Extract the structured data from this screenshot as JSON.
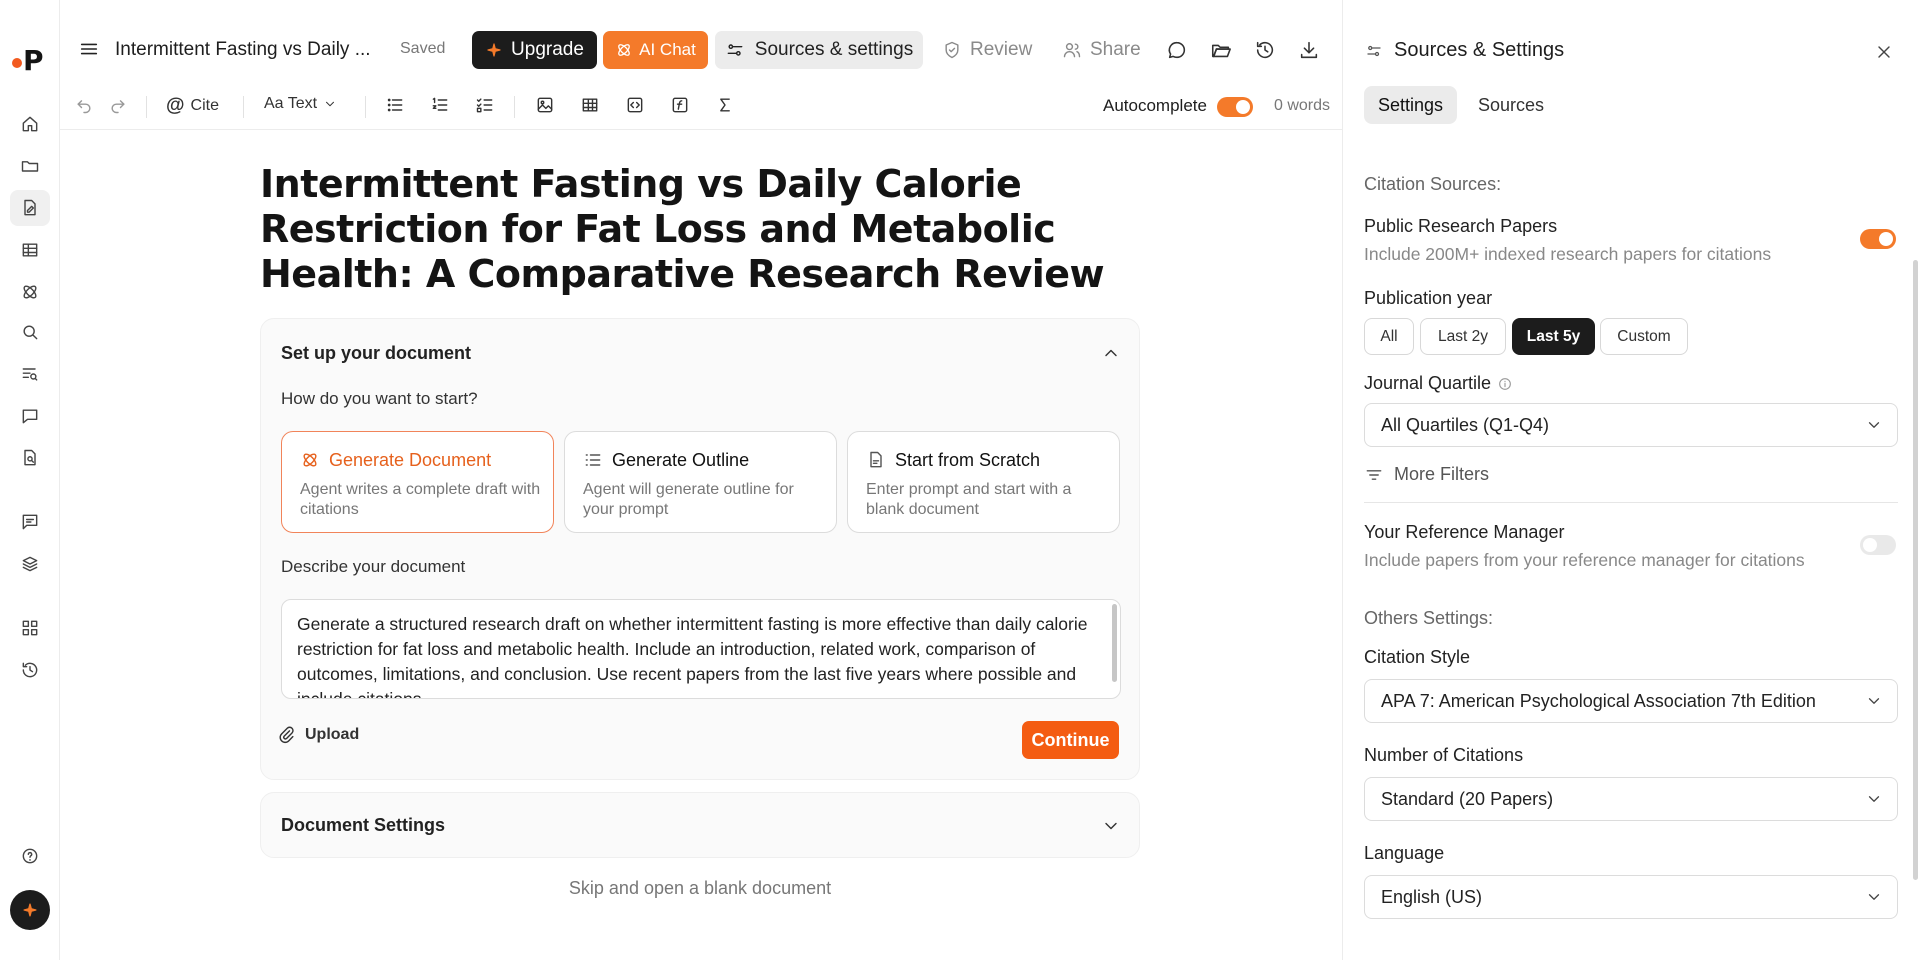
{
  "header": {
    "doc_title": "Intermittent Fasting vs Daily ...",
    "saved": "Saved",
    "upgrade": "Upgrade",
    "ai_chat": "AI Chat",
    "sources_settings": "Sources & settings",
    "review": "Review",
    "share": "Share"
  },
  "toolbar": {
    "cite": "Cite",
    "text_style": "Aa Text",
    "autocomplete": "Autocomplete",
    "autocomplete_on": true,
    "word_count": "0 words"
  },
  "document": {
    "title": "Intermittent Fasting vs Daily Calorie Restriction for Fat Loss and Metabolic Health: A Comparative Research Review"
  },
  "setup": {
    "heading": "Set up your document",
    "question": "How do you want to start?",
    "options": [
      {
        "title": "Generate Document",
        "desc": "Agent writes a complete draft with citations",
        "icon": "atom-icon",
        "selected": true
      },
      {
        "title": "Generate Outline",
        "desc": "Agent will generate outline for your prompt",
        "icon": "list-icon",
        "selected": false
      },
      {
        "title": "Start from Scratch",
        "desc": "Enter prompt and start with a blank document",
        "icon": "file-icon",
        "selected": false
      }
    ],
    "describe_label": "Describe your document",
    "prompt": "Generate a structured research draft on whether intermittent fasting is more effective than daily calorie restriction for fat loss and metabolic health. Include an introduction, related work, comparison of outcomes, limitations, and conclusion. Use recent papers from the last five years where possible and include citations.",
    "upload": "Upload",
    "continue": "Continue"
  },
  "document_settings": "Document Settings",
  "skip": "Skip and open a blank document",
  "panel": {
    "title": "Sources & Settings",
    "tabs": [
      "Settings",
      "Sources"
    ],
    "citation_sources": "Citation Sources:",
    "public_papers_title": "Public Research Papers",
    "public_papers_sub": "Include 200M+ indexed research papers for citations",
    "public_papers_on": true,
    "publication_year": "Publication year",
    "year_options": [
      "All",
      "Last 2y",
      "Last 5y",
      "Custom"
    ],
    "year_selected": "Last 5y",
    "journal_quartile": "Journal Quartile",
    "quartile_value": "All Quartiles (Q1-Q4)",
    "more_filters": "More Filters",
    "ref_manager_title": "Your Reference Manager",
    "ref_manager_sub": "Include papers from your reference manager for citations",
    "ref_manager_on": false,
    "others_settings": "Others Settings:",
    "citation_style_label": "Citation Style",
    "citation_style_value": "APA 7: American Psychological Association 7th Edition",
    "num_citations_label": "Number of Citations",
    "num_citations_value": "Standard (20 Papers)",
    "language_label": "Language",
    "language_value": "English (US)"
  },
  "colors": {
    "accent": "#f47a2a",
    "continue": "#f45c12",
    "dark": "#1c1c1c"
  }
}
